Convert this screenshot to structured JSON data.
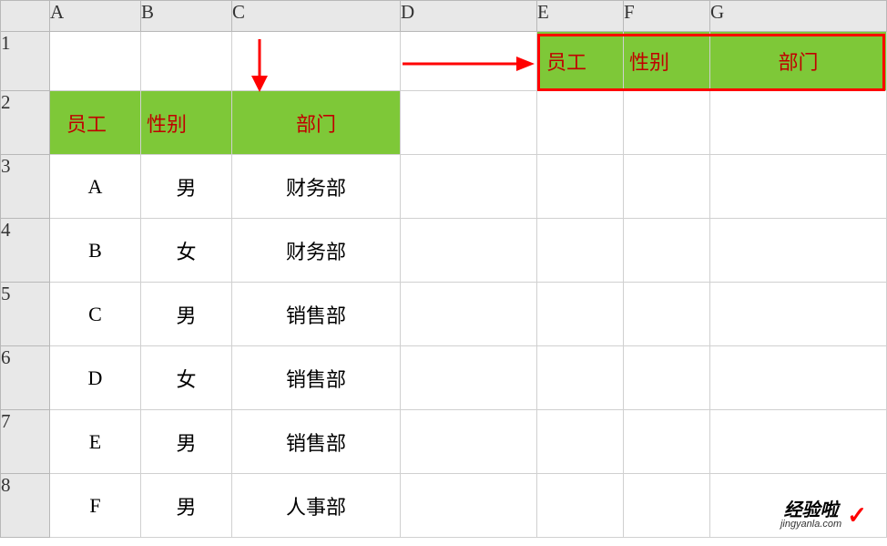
{
  "columns": [
    "A",
    "B",
    "C",
    "D",
    "E",
    "F",
    "G"
  ],
  "rows": [
    "1",
    "2",
    "3",
    "4",
    "5",
    "6",
    "7",
    "8"
  ],
  "headers_left": {
    "employee": "员工",
    "gender": "性别",
    "department": "部门"
  },
  "headers_right": {
    "employee": "员工",
    "gender": "性别",
    "department": "部门"
  },
  "table_data": [
    {
      "emp": "A",
      "gender": "男",
      "dept": "财务部"
    },
    {
      "emp": "B",
      "gender": "女",
      "dept": "财务部"
    },
    {
      "emp": "C",
      "gender": "男",
      "dept": "销售部"
    },
    {
      "emp": "D",
      "gender": "女",
      "dept": "销售部"
    },
    {
      "emp": "E",
      "gender": "男",
      "dept": "销售部"
    },
    {
      "emp": "F",
      "gender": "男",
      "dept": "人事部"
    }
  ],
  "watermark": {
    "text": "经验啦",
    "url": "jingyanla.com",
    "check": "✓"
  }
}
